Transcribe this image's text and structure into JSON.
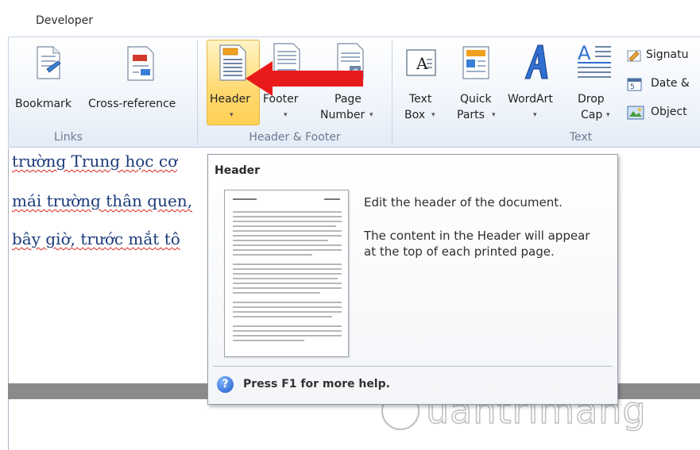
{
  "tabbar": {
    "active_tab": "Developer"
  },
  "ribbon": {
    "groups": [
      {
        "label": "Links"
      },
      {
        "label": "Header & Footer"
      },
      {
        "label": "Text"
      }
    ],
    "buttons": {
      "bookmark": "Bookmark",
      "cross_reference": "Cross-reference",
      "header": "Header",
      "footer": "Footer",
      "page_number_1": "Page",
      "page_number_2": "Number",
      "text_box_1": "Text",
      "text_box_2": "Box",
      "quick_parts_1": "Quick",
      "quick_parts_2": "Parts",
      "wordart": "WordArt",
      "drop_cap_1": "Drop",
      "drop_cap_2": "Cap",
      "signature": "Signatu",
      "date_time": "Date &",
      "object": "Object"
    },
    "dropdown_arrow": "▾"
  },
  "document": {
    "lines": [
      "trường Trung học cơ",
      "mái trường thân quen,",
      "bây giờ, trước mắt tô"
    ]
  },
  "tooltip": {
    "title": "Header",
    "desc1": "Edit the header of the document.",
    "desc2": "The content in the Header will appear at the top of each printed page.",
    "help_icon": "?",
    "help": "Press F1 for more help."
  },
  "watermark": {
    "text": "uantrimang"
  },
  "colors": {
    "highlight": "#ffd970",
    "arrow": "#e81a1a",
    "doc_text": "#1b3b7a"
  }
}
